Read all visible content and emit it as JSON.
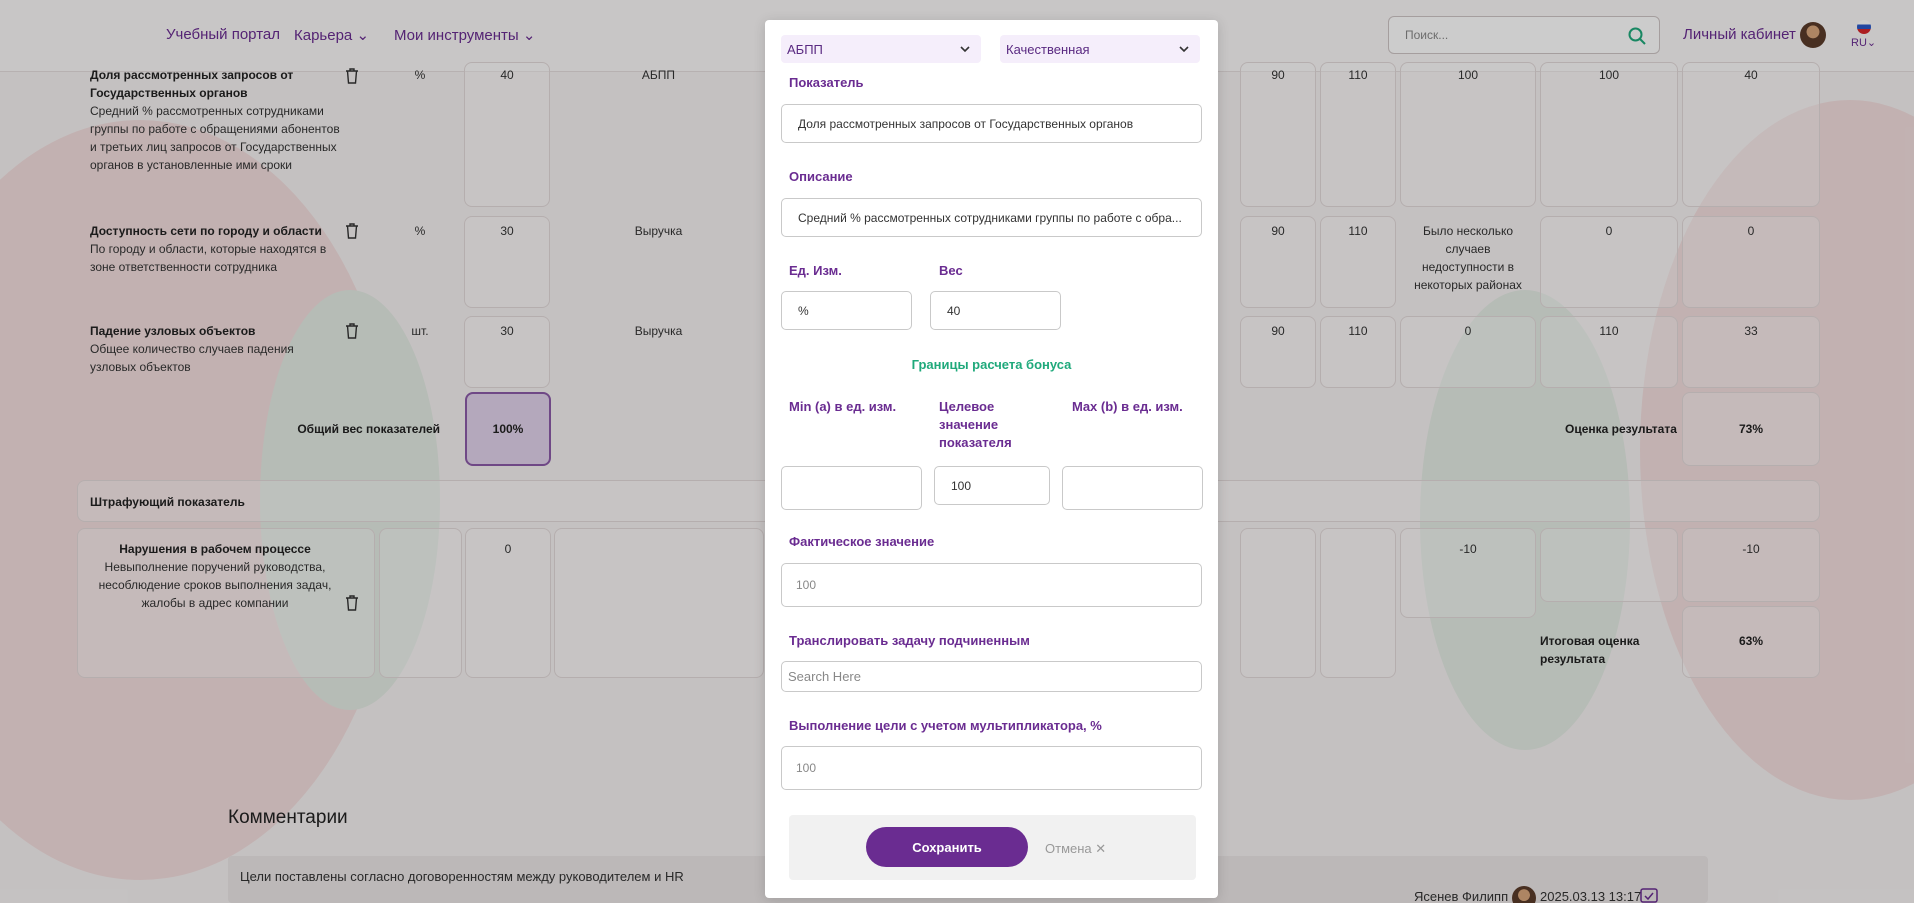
{
  "nav": {
    "items": [
      "Учебный портал",
      "Карьера",
      "Мои инструменты"
    ],
    "search_placeholder": "Поиск...",
    "cabinet": "Личный кабинет",
    "lang": "RU"
  },
  "table": {
    "rows": [
      {
        "title": "Доля рассмотренных запросов от Государственных органов",
        "desc": "Средний % рассмотренных сотрудниками группы по работе с обращениями абонентов и третьих лиц запросов от Государственных органов в установленные ими сроки",
        "unit": "%",
        "weight": "40",
        "source": "АБПП",
        "min": "90",
        "max": "110",
        "fact": "100",
        "exec": "100",
        "score": "40"
      },
      {
        "title": "Доступность сети по городу и области",
        "desc": "По городу и области, которые находятся в зоне ответственности сотрудника",
        "unit": "%",
        "weight": "30",
        "source": "Выручка",
        "min": "90",
        "max": "110",
        "fact": "Было несколько случаев недоступности в некоторых районах",
        "exec": "0",
        "score": "0"
      },
      {
        "title": "Падение узловых объектов",
        "desc": "Общее количество случаев падения узловых объектов",
        "unit": "шт.",
        "weight": "30",
        "source": "Выручка",
        "min": "90",
        "max": "110",
        "fact": "0",
        "exec": "110",
        "score": "33"
      }
    ],
    "total_weight_label": "Общий вес показателей",
    "total_weight": "100%",
    "result_label": "Оценка результата",
    "result_value": "73%",
    "penalty_header": "Штрафующий показатель",
    "penalty": {
      "title": "Нарушения в рабочем процессе",
      "desc": "Невыполнение поручений руководства, несоблюдение сроков выполнения задач, жалобы в адрес компании",
      "weight": "0",
      "fact": "-10",
      "score": "-10"
    },
    "final_label": "Итоговая оценка результата",
    "final_value": "63%"
  },
  "comments": {
    "title": "Комментарии",
    "text": "Цели поставлены согласно договоренностям между руководителем и HR",
    "author": "Ясенев Филипп",
    "date": "2025.03.13 13:17"
  },
  "modal": {
    "select_left": "АБПП",
    "select_right": "Качественная",
    "indicator_label": "Показатель",
    "indicator_value": "Доля рассмотренных запросов от Государственных органов",
    "description_label": "Описание",
    "description_value": "Средний % рассмотренных  сотрудниками группы по работе с обра...",
    "unit_label": "Ед. Изм.",
    "unit_value": "%",
    "weight_label": "Вес",
    "weight_value": "40",
    "bonus_title": "Границы расчета бонуса",
    "min_label": "Min (a) в ед. изм.",
    "target_label": "Целевое значение показателя",
    "max_label": "Max (b) в ед. изм.",
    "min_value": "",
    "target_value": "100",
    "max_value": "",
    "fact_label": "Фактическое значение",
    "fact_placeholder": "100",
    "broadcast_label": "Транслировать задачу подчиненным",
    "broadcast_placeholder": "Search Here",
    "completion_label": "Выполнение цели с учетом мультипликатора, %",
    "completion_placeholder": "100",
    "save": "Сохранить",
    "cancel": "Отмена ✕"
  },
  "colors": {
    "accent": "#6a2c91",
    "bonus": "#1fa97b"
  }
}
